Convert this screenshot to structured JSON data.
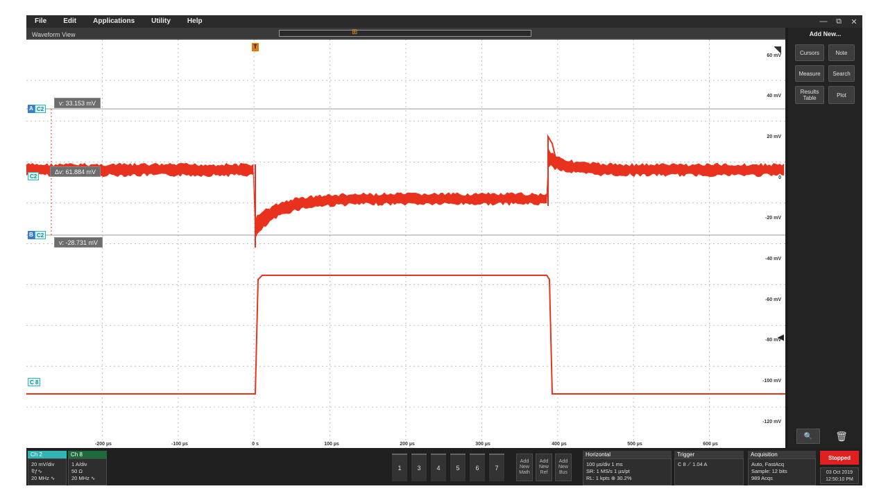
{
  "menu": [
    "File",
    "Edit",
    "Applications",
    "Utility",
    "Help"
  ],
  "window_controls": [
    "—",
    "⧉",
    "✕"
  ],
  "waveform_view": {
    "title": "Waveform View"
  },
  "trigger_marker": "T",
  "cursors": {
    "a_readout": "v: 33.153 mV",
    "delta_readout": "Δv: 61.884 mV",
    "b_readout": "v: -28.731 mV",
    "a_letter": "A",
    "b_letter": "B",
    "channel_label": "C2",
    "ch8_label": "C 8"
  },
  "y_axis_labels": [
    "60 mV",
    "40 mV",
    "20 mV",
    "0",
    "-20 mV",
    "-40 mV",
    "-60 mV",
    "-80 mV",
    "-100 mV",
    "-120 mV"
  ],
  "x_axis_labels": [
    "-200 µs",
    "-100 µs",
    "0 s",
    "100 µs",
    "200 µs",
    "300 µs",
    "400 µs",
    "500 µs",
    "600 µs"
  ],
  "right_panel": {
    "title": "Add New...",
    "buttons": [
      "Cursors",
      "Note",
      "Measure",
      "Search",
      "Results Table",
      "Plot"
    ]
  },
  "bottom": {
    "ch2": {
      "head": "Ch 2",
      "lines": [
        "20 mV/div",
        "⅊ƒ∿",
        "20 MHz ∿"
      ]
    },
    "ch8": {
      "head": "Ch 8",
      "lines": [
        "1 A/div",
        "50 Ω",
        "20 MHz ∿"
      ]
    },
    "channel_buttons": [
      "1",
      "3",
      "4",
      "5",
      "6",
      "7"
    ],
    "add_buttons": [
      "Add New Math",
      "Add New Ref",
      "Add New Bus"
    ],
    "horizontal": {
      "head": "Horizontal",
      "lines": [
        "100 µs/div    1 ms",
        "SR: 1 MS/s    1 µs/pt",
        "RL: 1 kpts    ⊕ 30.2%"
      ]
    },
    "trigger": {
      "head": "Trigger",
      "lines": [
        "C 8  ⟋  1.04 A"
      ]
    },
    "acquisition": {
      "head": "Acquisition",
      "lines": [
        "Auto,    FastAcq",
        "Sample: 12 bits",
        "989 Acqs"
      ]
    },
    "stopped": "Stopped",
    "datetime": [
      "03 Oct 2019",
      "12:50:10 PM"
    ]
  },
  "colors": {
    "waveform": "#e8321e",
    "cursor_line": "#9a9a9a",
    "channel": "#32b4b4"
  }
}
